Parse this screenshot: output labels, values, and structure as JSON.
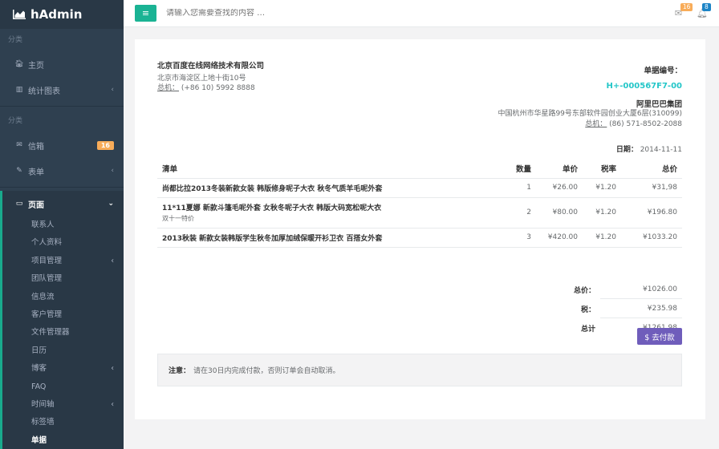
{
  "brand": {
    "name": "hAdmin"
  },
  "sidebar": {
    "section1": "分类",
    "home": "主页",
    "stats": "统计图表",
    "section2": "分类",
    "mail": "信箱",
    "mail_badge": "16",
    "forms": "表单",
    "pages": "页面",
    "sub": [
      "联系人",
      "个人资料",
      "项目管理",
      "团队管理",
      "信息流",
      "客户管理",
      "文件管理器",
      "日历",
      "博客",
      "FAQ",
      "时间轴",
      "标签墙",
      "单据"
    ]
  },
  "topbar": {
    "search_placeholder": "请输入您需要查找的内容 …",
    "mail_count": "16",
    "bell_count": "8"
  },
  "invoice": {
    "from_name": "北京百度在线网络技术有限公司",
    "from_address": "北京市海淀区上地十街10号",
    "from_phone_label": "总机：",
    "from_phone": " (+86 10) 5992 8888",
    "no_label": "单据编号：",
    "no": "H+-000567F7-00",
    "to_name": "阿里巴巴集团",
    "to_address": "中国杭州市华星路99号东部软件园创业大厦6层(310099)",
    "to_phone_label": "总机：",
    "to_phone": " (86) 571-8502-2088",
    "date_label": "日期：",
    "date": " 2014-11-11",
    "headers": {
      "item": "清单",
      "qty": "数量",
      "price": "单价",
      "tax": "税率",
      "total": "总价"
    },
    "rows": [
      {
        "item": "尚都比拉2013冬装新款女装 韩版修身呢子大衣 秋冬气质羊毛呢外套",
        "sub": "",
        "qty": "1",
        "price": "¥26.00",
        "tax": "¥1.20",
        "total": "¥31,98"
      },
      {
        "item": "11*11夏娜 新款斗篷毛呢外套 女秋冬呢子大衣 韩版大码宽松呢大衣",
        "sub": "双十一特价",
        "qty": "2",
        "price": "¥80.00",
        "tax": "¥1.20",
        "total": "¥196.80"
      },
      {
        "item": "2013秋装 新款女装韩版学生秋冬加厚加绒保暖开衫卫衣 百搭女外套",
        "sub": "",
        "qty": "3",
        "price": "¥420.00",
        "tax": "¥1.20",
        "total": "¥1033.20"
      }
    ],
    "subtotal_label": "总价：",
    "subtotal": "¥1026.00",
    "tax_label": "税：",
    "tax": "¥235.98",
    "grand_label": "总计",
    "grand": "¥1261.98",
    "pay_label": "$ 去付款",
    "note_label": "注意：",
    "note": "请在30日内完成付款，否则订单会自动取消。"
  },
  "colors": {
    "sidebar": "#2f4050",
    "accent": "#1ab394",
    "pay": "#6f5dbb",
    "invoice_no": "#23c6c8"
  }
}
